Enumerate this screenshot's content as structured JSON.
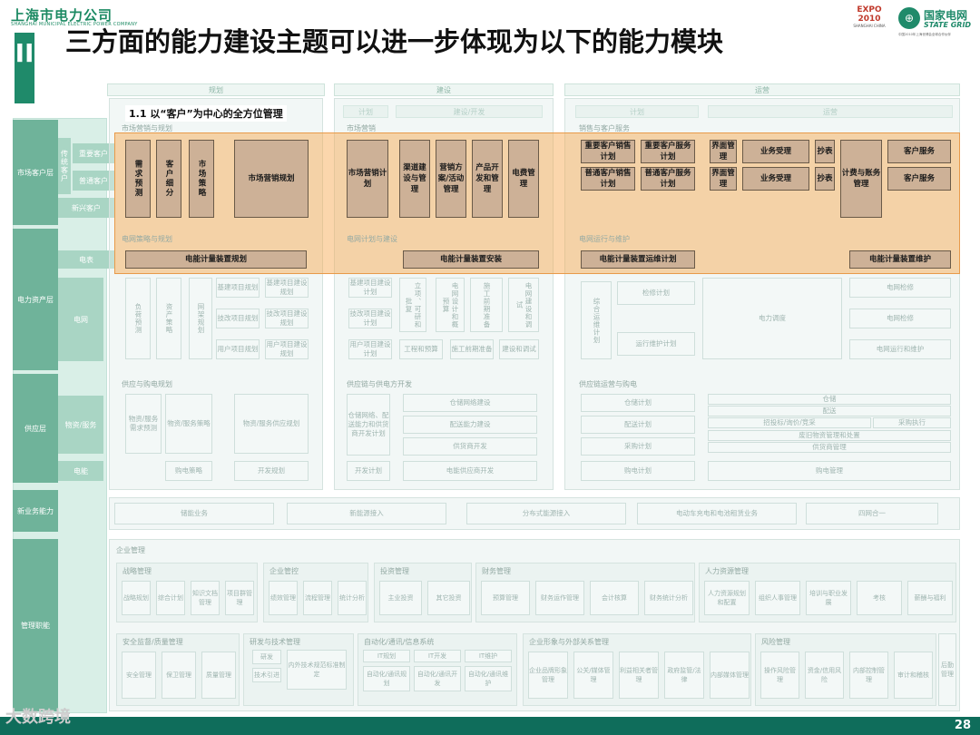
{
  "header": {
    "company_cn": "上海市电力公司",
    "company_en": "SHANGHAI MUNICIPAL ELECTRIC POWER COMPANY",
    "section_mark": "II",
    "title": "三方面的能力建设主题可以进一步体现为以下的能力模块",
    "expo": "EXPO 2010",
    "expo_sub": "SHANGHAI CHINA",
    "sg_cn": "国家电网",
    "sg_en": "STATE GRID",
    "sg_small": "中国2010年上海世博会全球合作伙伴"
  },
  "caption": "1.1 以“客户”为中心的全方位管理",
  "phases": [
    "规划",
    "建设",
    "运营"
  ],
  "subphases": [
    "计划",
    "建设/开发",
    "计划",
    "运营"
  ],
  "left_rows": [
    "市场客户层",
    "电力资产层",
    "供应层",
    "新业务能力",
    "管理职能"
  ],
  "left_sub": [
    "传统客户",
    "重要客户",
    "普通客户",
    "新兴客户",
    "电表",
    "电网",
    "物资/服务",
    "电能"
  ],
  "planning_sections": [
    "市场营销与规划",
    "电网策略与规划",
    "供应与购电规划"
  ],
  "construction_sections": [
    "市场营销",
    "电网计划与建设",
    "供应链与供电方开发"
  ],
  "operation_sections": [
    "销售与客户服务",
    "电网运行与维护",
    "供应链运营与购电"
  ],
  "highlight": {
    "p1": [
      "需求预测",
      "客户细分",
      "市场策略",
      "市场营销规划"
    ],
    "p2": [
      "市场营销计划",
      "渠道建设与管理",
      "营销方案/活动管理",
      "产品开发和管理",
      "电费管理"
    ],
    "p3": [
      "重要客户销售计划",
      "重要客户服务计划",
      "界面管理",
      "业务受理",
      "抄表",
      "计费与账务管理",
      "客户服务",
      "普通客户销售计划",
      "普通客户服务计划",
      "界面管理",
      "业务受理",
      "抄表",
      "客户服务"
    ],
    "meter": [
      "电能计量装置规划",
      "电能计量装置安装",
      "电能计量装置运维计划",
      "电能计量装置维护"
    ]
  },
  "faded": {
    "grid_plan": [
      "负荷预测",
      "资产策略",
      "网架规划",
      "基建项目规划",
      "基建项目建设规划",
      "技改项目规划",
      "技改项目建设规划",
      "用户项目规划",
      "用户项目建设规划"
    ],
    "grid_build": [
      "基建项目建设计划",
      "技改项目建设计划",
      "用户项目建设计划",
      "立项、可研和批复",
      "电网设计和概预算",
      "施工前期准备",
      "电网建设和调试",
      "工程和预算",
      "施工前期准备",
      "建设和调试"
    ],
    "grid_ops": [
      "检修计划",
      "综合运维计划",
      "运行维护计划",
      "电力调度",
      "电网检修",
      "电网检修",
      "电网运行和维护",
      "电网抢修"
    ],
    "supply_plan": [
      "物资/服务需求预测",
      "物资/服务策略",
      "物资/服务供应规划",
      "购电策略",
      "开发规划"
    ],
    "supply_build": [
      "仓储网络建设",
      "配送能力建设",
      "供货商开发",
      "电能供应商开发",
      "仓储网络、配送能力和供货商开发计划",
      "开发计划"
    ],
    "supply_ops": [
      "仓储计划",
      "配送计划",
      "采购计划",
      "购电计划",
      "仓储",
      "配送",
      "招投标/询价/竞采",
      "采购执行",
      "废旧物资管理和处置",
      "供货商管理",
      "购电管理"
    ],
    "new_biz": [
      "储能业务",
      "新能源接入",
      "分布式能源接入",
      "电动车充电和电池租赁业务",
      "四网合一"
    ],
    "mgmt_title": "企业管理",
    "mgmt_groups": [
      "战略管理",
      "企业管控",
      "投资管理",
      "财务管理",
      "人力资源管理",
      "安全监督/质量管理",
      "研发与技术管理",
      "自动化/通讯/信息系统",
      "企业形象与外部关系管理",
      "风险管理"
    ],
    "mgmt_items": [
      "战略规划",
      "综合计划",
      "知识文档管理",
      "项目群管理",
      "绩效管理",
      "流程管理",
      "统计分析",
      "主业投资",
      "其它投资",
      "预算管理",
      "财务运作管理",
      "会计核算",
      "财务统计分析",
      "人力资源规划和配置",
      "组织人事管理",
      "培训与职业发展",
      "考核",
      "薪酬与福利",
      "安全管理",
      "保卫管理",
      "质量管理",
      "研发",
      "技术引进",
      "内外技术规范标准制定",
      "IT规划",
      "IT开发",
      "IT维护",
      "自动化/通讯规划",
      "自动化/通讯开发",
      "自动化/通讯维护",
      "企业品牌形象管理",
      "公关/媒体管理",
      "利益相关者管理",
      "政府监管/法律",
      "内部媒体管理",
      "操作风险管理",
      "资金/信用风险",
      "内部控制管理",
      "审计和稽核",
      "后勤管理"
    ]
  },
  "footer": {
    "page": "28",
    "watermark": "大数跨境"
  }
}
